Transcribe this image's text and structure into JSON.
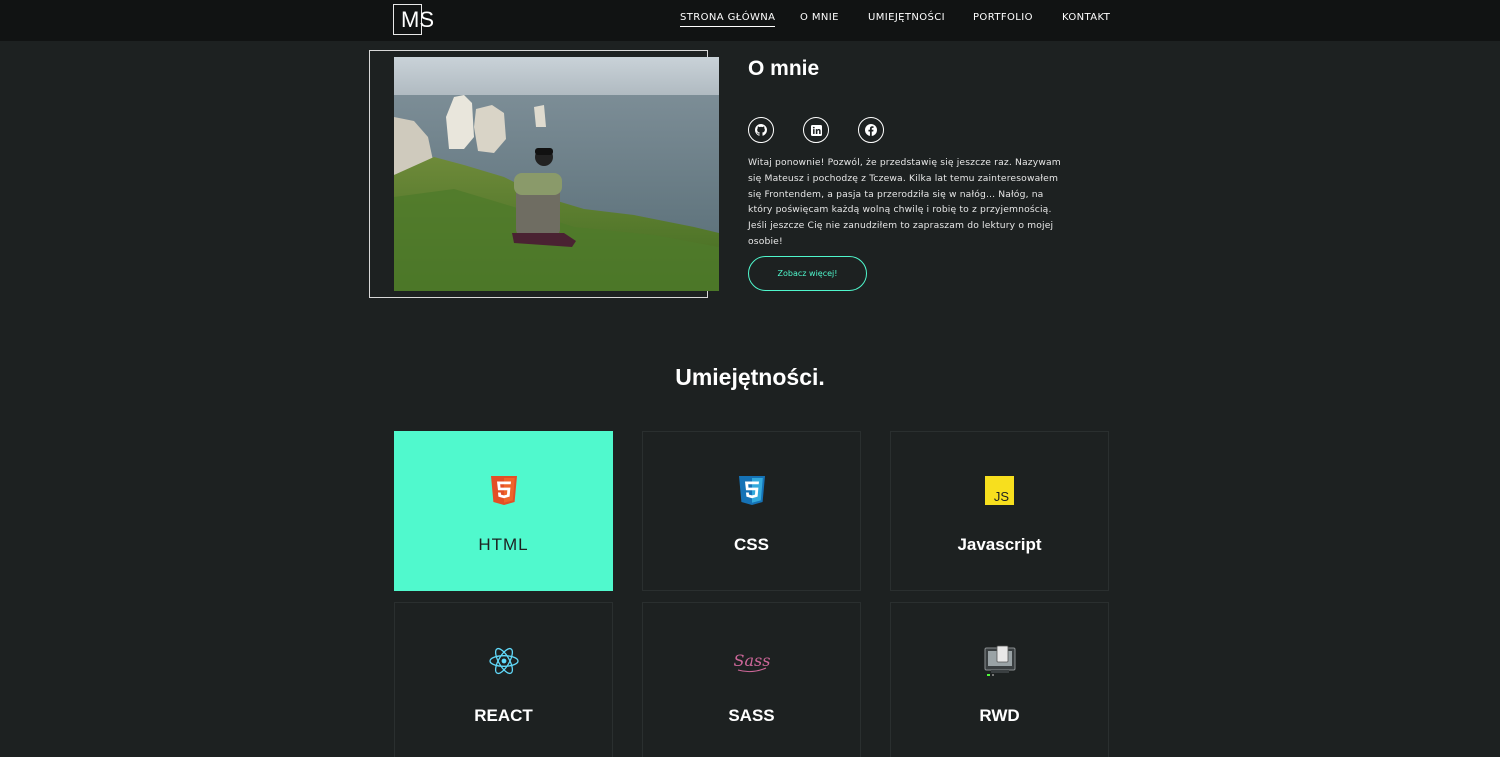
{
  "logo": {
    "text": "MS"
  },
  "nav": {
    "items": [
      {
        "label": "STRONA GŁÓWNA",
        "active": true
      },
      {
        "label": "O MNIE",
        "active": false
      },
      {
        "label": "UMIEJĘTNOŚCI",
        "active": false
      },
      {
        "label": "PORTFOLIO",
        "active": false
      },
      {
        "label": "KONTAKT",
        "active": false
      }
    ]
  },
  "about": {
    "title": "O mnie",
    "social": [
      {
        "icon": "github-icon"
      },
      {
        "icon": "linkedin-icon"
      },
      {
        "icon": "facebook-icon"
      }
    ],
    "lines": [
      "Witaj ponownie! Pozwól, że przedstawię się jeszcze raz. Nazywam",
      "się Mateusz i pochodzę z Tczewa. Kilka lat temu zainteresowałem",
      "się Frontendem, a pasja ta przerodziła się w nałóg... Nałóg, na",
      "który poświęcam każdą wolną chwilę i robię to z przyjemnością.",
      "Jeśli jeszcze Cię nie zanudziłem to zapraszam do lektury o mojej",
      "osobie!"
    ],
    "button_label": "Zobacz więcej!"
  },
  "skills": {
    "title": "Umiejętności.",
    "accent_color": "#50f9cd",
    "items": [
      {
        "label": "HTML",
        "icon": "html5-icon",
        "active": true
      },
      {
        "label": "CSS",
        "icon": "css3-icon",
        "active": false
      },
      {
        "label": "Javascript",
        "icon": "javascript-icon",
        "active": false
      },
      {
        "label": "REACT",
        "icon": "react-icon",
        "active": false
      },
      {
        "label": "SASS",
        "icon": "sass-icon",
        "active": false
      },
      {
        "label": "RWD",
        "icon": "rwd-icon",
        "active": false
      }
    ]
  }
}
